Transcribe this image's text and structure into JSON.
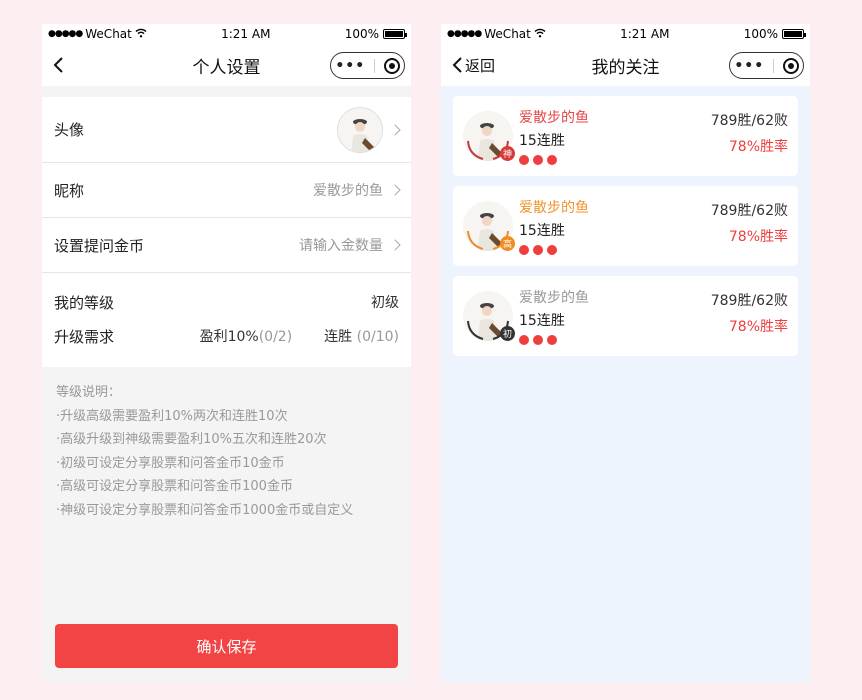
{
  "colors": {
    "accent": "#f24444",
    "red_name": "#e84545",
    "orange_name": "#f0932b",
    "gray_name": "#999999",
    "badge_god": "#d93b3b",
    "badge_high": "#f08c20",
    "badge_low": "#333333"
  },
  "left": {
    "status": {
      "carrier": "WeChat",
      "time": "1:21 AM",
      "battery": "100%",
      "battery_level": 1.0
    },
    "nav": {
      "title": "个人设置",
      "back_icon": "chevron-left-icon"
    },
    "rows": {
      "avatar_label": "头像",
      "nick_label": "昵称",
      "nick_value": "爱散步的鱼",
      "gold_label": "设置提问金币",
      "gold_placeholder": "请输入金数量"
    },
    "level": {
      "label": "我的等级",
      "value": "初级",
      "req_label": "升级需求",
      "req1_label": "盈利10%",
      "req1_progress": "(0/2)",
      "req2_label": "连胜",
      "req2_progress": "(0/10)"
    },
    "notes": {
      "title": "等级说明：",
      "items": [
        "·升级高级需要盈利10%两次和连胜10次",
        "·高级升级到神级需要盈利10%五次和连胜20次",
        "·初级可设定分享股票和问答金币10金币",
        "·高级可设定分享股票和问答金币100金币",
        "·神级可设定分享股票和问答金币1000金币或自定义"
      ]
    },
    "save_label": "确认保存"
  },
  "right": {
    "status": {
      "carrier": "WeChat",
      "time": "1:21 AM",
      "battery": "100%",
      "battery_level": 1.0
    },
    "nav": {
      "title": "我的关注",
      "back_label": "返回"
    },
    "cards": [
      {
        "name": "爱散步的鱼",
        "streak": "15连胜",
        "record": "789胜/62败",
        "winrate": "78%胜率",
        "badge": "神",
        "tier": "god"
      },
      {
        "name": "爱散步的鱼",
        "streak": "15连胜",
        "record": "789胜/62败",
        "winrate": "78%胜率",
        "badge": "高",
        "tier": "high"
      },
      {
        "name": "爱散步的鱼",
        "streak": "15连胜",
        "record": "789胜/62败",
        "winrate": "78%胜率",
        "badge": "初",
        "tier": "low"
      }
    ]
  }
}
